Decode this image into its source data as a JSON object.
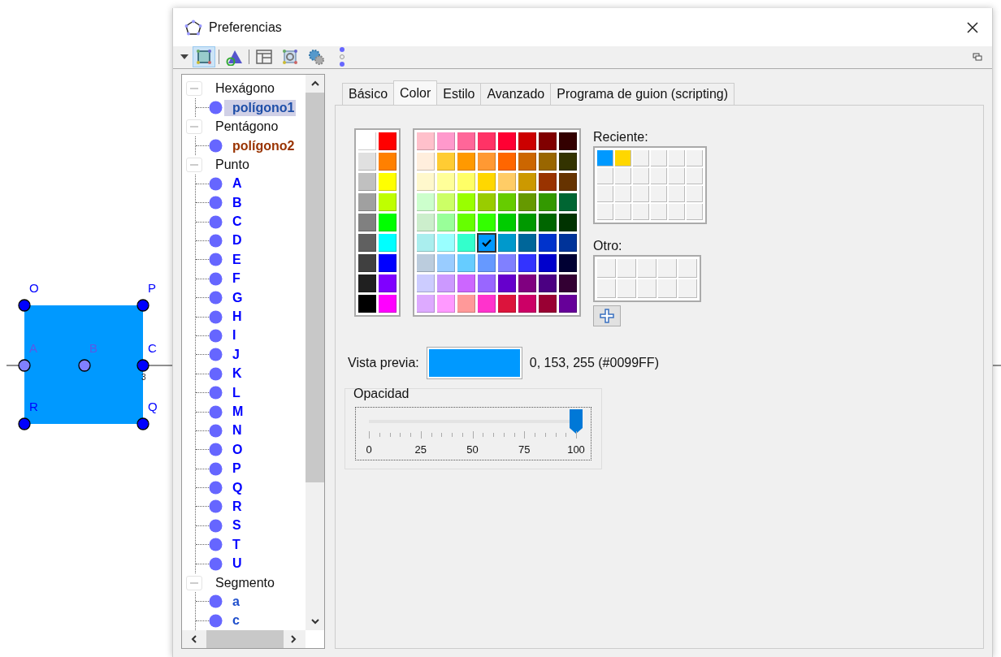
{
  "canvas": {
    "points": [
      {
        "label": "O",
        "kind": "free"
      },
      {
        "label": "P",
        "kind": "free"
      },
      {
        "label": "A",
        "kind": "fixed"
      },
      {
        "label": "B",
        "kind": "fixed"
      },
      {
        "label": "C",
        "kind": "free"
      },
      {
        "label": "R",
        "kind": "free"
      },
      {
        "label": "Q",
        "kind": "free"
      }
    ],
    "axis_tick": "3"
  },
  "window": {
    "title": "Preferencias"
  },
  "toolbar": [
    {
      "kind": "polygon",
      "selected": true
    },
    {
      "kind": "shapes",
      "selected": false
    },
    {
      "kind": "layout",
      "selected": false
    },
    {
      "kind": "graphics",
      "selected": false
    },
    {
      "kind": "gears",
      "selected": false
    },
    {
      "kind": "more",
      "selected": false
    }
  ],
  "tree": [
    {
      "label": "Hexágono",
      "expanded": true,
      "children": [
        {
          "label": "polígono1",
          "color": "#1f4fa8",
          "selected": true
        }
      ]
    },
    {
      "label": "Pentágono",
      "expanded": true,
      "children": [
        {
          "label": "polígono2",
          "color": "#993300",
          "selected": false
        }
      ]
    },
    {
      "label": "Punto",
      "expanded": true,
      "children": [
        {
          "label": "A",
          "color": "#0000ff",
          "selected": false
        },
        {
          "label": "B",
          "color": "#0000ff",
          "selected": false
        },
        {
          "label": "C",
          "color": "#0000ff",
          "selected": false
        },
        {
          "label": "D",
          "color": "#0000ff",
          "selected": false
        },
        {
          "label": "E",
          "color": "#0000ff",
          "selected": false
        },
        {
          "label": "F",
          "color": "#0000ff",
          "selected": false
        },
        {
          "label": "G",
          "color": "#0000ff",
          "selected": false
        },
        {
          "label": "H",
          "color": "#0000ff",
          "selected": false
        },
        {
          "label": "I",
          "color": "#0000ff",
          "selected": false
        },
        {
          "label": "J",
          "color": "#0000ff",
          "selected": false
        },
        {
          "label": "K",
          "color": "#0000ff",
          "selected": false
        },
        {
          "label": "L",
          "color": "#0000ff",
          "selected": false
        },
        {
          "label": "M",
          "color": "#0000ff",
          "selected": false
        },
        {
          "label": "N",
          "color": "#0000ff",
          "selected": false
        },
        {
          "label": "O",
          "color": "#0000ff",
          "selected": false
        },
        {
          "label": "P",
          "color": "#0000ff",
          "selected": false
        },
        {
          "label": "Q",
          "color": "#0000ff",
          "selected": false
        },
        {
          "label": "R",
          "color": "#0000ff",
          "selected": false
        },
        {
          "label": "S",
          "color": "#0000ff",
          "selected": false
        },
        {
          "label": "T",
          "color": "#0000ff",
          "selected": false
        },
        {
          "label": "U",
          "color": "#0000ff",
          "selected": false
        }
      ]
    },
    {
      "label": "Segmento",
      "expanded": true,
      "children": [
        {
          "label": "a",
          "color": "#1f4fcc",
          "selected": false
        },
        {
          "label": "c",
          "color": "#1f4fcc",
          "selected": false
        }
      ]
    }
  ],
  "tabs": [
    {
      "label": "Básico",
      "selected": false
    },
    {
      "label": "Color",
      "selected": true
    },
    {
      "label": "Estilo",
      "selected": false
    },
    {
      "label": "Avanzado",
      "selected": false
    },
    {
      "label": "Programa de guion (scripting)",
      "selected": false
    }
  ],
  "basic_palette": [
    {
      "color": "#ffffff"
    },
    {
      "color": "#ff0000"
    },
    {
      "color": "#e0e0e0"
    },
    {
      "color": "#ff8000"
    },
    {
      "color": "#c0c0c0"
    },
    {
      "color": "#ffff00"
    },
    {
      "color": "#a0a0a0"
    },
    {
      "color": "#bfff00"
    },
    {
      "color": "#808080"
    },
    {
      "color": "#00ff00"
    },
    {
      "color": "#606060"
    },
    {
      "color": "#00ffff"
    },
    {
      "color": "#404040"
    },
    {
      "color": "#0000ff"
    },
    {
      "color": "#202020"
    },
    {
      "color": "#8000ff"
    },
    {
      "color": "#000000"
    },
    {
      "color": "#ff00ff"
    }
  ],
  "palette": [
    {
      "color": "#ffc0cb",
      "selected": false
    },
    {
      "color": "#ff99cc",
      "selected": false
    },
    {
      "color": "#ff6699",
      "selected": false
    },
    {
      "color": "#ff3366",
      "selected": false
    },
    {
      "color": "#ff0033",
      "selected": false
    },
    {
      "color": "#cc0000",
      "selected": false
    },
    {
      "color": "#800000",
      "selected": false
    },
    {
      "color": "#330000",
      "selected": false
    },
    {
      "color": "#ffeedd",
      "selected": false
    },
    {
      "color": "#ffcc33",
      "selected": false
    },
    {
      "color": "#ff9900",
      "selected": false
    },
    {
      "color": "#ff9933",
      "selected": false
    },
    {
      "color": "#ff6600",
      "selected": false
    },
    {
      "color": "#cc6600",
      "selected": false
    },
    {
      "color": "#996600",
      "selected": false
    },
    {
      "color": "#333300",
      "selected": false
    },
    {
      "color": "#fff8cc",
      "selected": false
    },
    {
      "color": "#ffff99",
      "selected": false
    },
    {
      "color": "#ffff66",
      "selected": false
    },
    {
      "color": "#ffd700",
      "selected": false
    },
    {
      "color": "#ffcc66",
      "selected": false
    },
    {
      "color": "#cc9900",
      "selected": false
    },
    {
      "color": "#993300",
      "selected": false
    },
    {
      "color": "#663300",
      "selected": false
    },
    {
      "color": "#ccffcc",
      "selected": false
    },
    {
      "color": "#ccff66",
      "selected": false
    },
    {
      "color": "#99ff00",
      "selected": false
    },
    {
      "color": "#99cc00",
      "selected": false
    },
    {
      "color": "#66cc00",
      "selected": false
    },
    {
      "color": "#669900",
      "selected": false
    },
    {
      "color": "#339900",
      "selected": false
    },
    {
      "color": "#006633",
      "selected": false
    },
    {
      "color": "#cceecc",
      "selected": false
    },
    {
      "color": "#99ff99",
      "selected": false
    },
    {
      "color": "#66ff00",
      "selected": false
    },
    {
      "color": "#33ff00",
      "selected": false
    },
    {
      "color": "#00cc00",
      "selected": false
    },
    {
      "color": "#009900",
      "selected": false
    },
    {
      "color": "#006600",
      "selected": false
    },
    {
      "color": "#003300",
      "selected": false
    },
    {
      "color": "#aaeeee",
      "selected": false
    },
    {
      "color": "#99ffff",
      "selected": false
    },
    {
      "color": "#33ffcc",
      "selected": false
    },
    {
      "color": "#0099ff",
      "selected": true
    },
    {
      "color": "#0099cc",
      "selected": false
    },
    {
      "color": "#006699",
      "selected": false
    },
    {
      "color": "#0033cc",
      "selected": false
    },
    {
      "color": "#003399",
      "selected": false
    },
    {
      "color": "#bbccdd",
      "selected": false
    },
    {
      "color": "#99ccff",
      "selected": false
    },
    {
      "color": "#66ccff",
      "selected": false
    },
    {
      "color": "#6699ff",
      "selected": false
    },
    {
      "color": "#8080ff",
      "selected": false
    },
    {
      "color": "#3333ff",
      "selected": false
    },
    {
      "color": "#0000cc",
      "selected": false
    },
    {
      "color": "#000033",
      "selected": false
    },
    {
      "color": "#ccccff",
      "selected": false
    },
    {
      "color": "#cc99ff",
      "selected": false
    },
    {
      "color": "#cc66ff",
      "selected": false
    },
    {
      "color": "#9966ff",
      "selected": false
    },
    {
      "color": "#6600cc",
      "selected": false
    },
    {
      "color": "#800080",
      "selected": false
    },
    {
      "color": "#4b0082",
      "selected": false
    },
    {
      "color": "#330033",
      "selected": false
    },
    {
      "color": "#ddaaff",
      "selected": false
    },
    {
      "color": "#ff99ff",
      "selected": false
    },
    {
      "color": "#ff9999",
      "selected": false
    },
    {
      "color": "#ff33cc",
      "selected": false
    },
    {
      "color": "#dc143c",
      "selected": false
    },
    {
      "color": "#cc0066",
      "selected": false
    },
    {
      "color": "#990033",
      "selected": false
    },
    {
      "color": "#660099",
      "selected": false
    }
  ],
  "recent": {
    "label": "Reciente:",
    "colors": [
      {
        "color": "#0099ff"
      },
      {
        "color": "#ffd700"
      }
    ]
  },
  "other": {
    "label": "Otro:"
  },
  "preview": {
    "label": "Vista previa:",
    "color": "#0099ff",
    "value": "0, 153, 255 (#0099FF)"
  },
  "opacity": {
    "label": "Opacidad",
    "level": 1,
    "ticks": [
      "0",
      "25",
      "50",
      "75",
      "100"
    ]
  }
}
